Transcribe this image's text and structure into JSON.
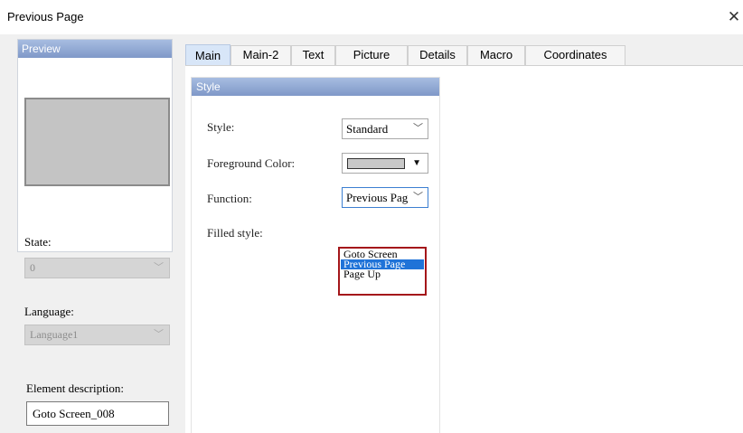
{
  "window": {
    "title": "Previous Page",
    "close_glyph": "✕"
  },
  "preview": {
    "header": "Preview"
  },
  "state": {
    "label": "State:",
    "value": "0"
  },
  "language": {
    "label": "Language:",
    "value": "Language1"
  },
  "description": {
    "label": "Element description:",
    "value": "Goto Screen_008"
  },
  "tabs": [
    {
      "label": "Main",
      "active": true
    },
    {
      "label": "Main-2"
    },
    {
      "label": "Text"
    },
    {
      "label": "Picture"
    },
    {
      "label": "Details"
    },
    {
      "label": "Macro"
    },
    {
      "label": "Coordinates"
    }
  ],
  "style_group": {
    "header": "Style",
    "style_label": "Style:",
    "style_value": "Standard",
    "fg_label": "Foreground Color:",
    "fg_color": "#c8c8c8",
    "function_label": "Function:",
    "function_value": "Previous Pag",
    "filled_label": "Filled style:"
  },
  "function_options": [
    {
      "label": "Goto Screen"
    },
    {
      "label": "Previous Page",
      "selected": true
    },
    {
      "label": "Page Up"
    }
  ],
  "colors": {
    "accent_header": "#8aa3d1",
    "selection": "#1f73d8",
    "highlight_border": "#a4161a"
  },
  "icons": {
    "chevron": "﹀",
    "dropdown_arrow": "▼"
  }
}
